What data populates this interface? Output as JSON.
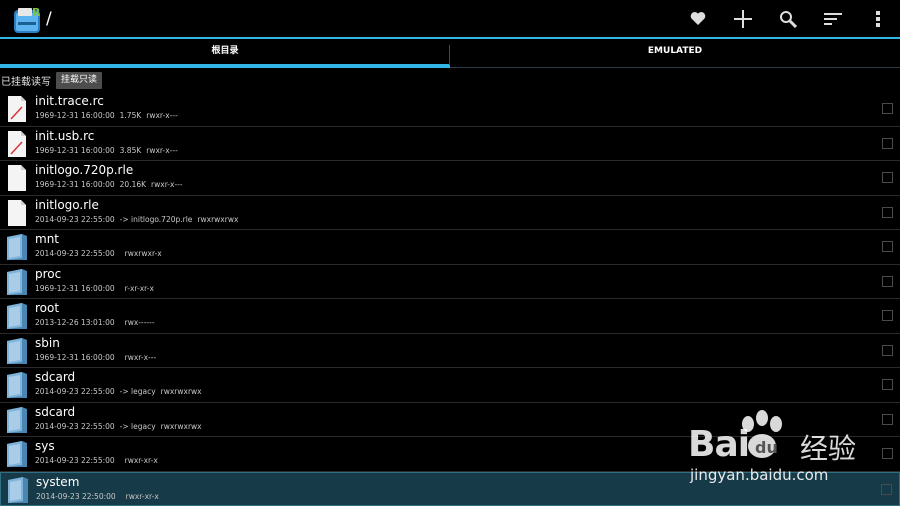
{
  "header": {
    "path": "/",
    "actions": [
      {
        "name": "favorite-icon"
      },
      {
        "name": "add-icon"
      },
      {
        "name": "search-icon"
      },
      {
        "name": "sort-icon"
      },
      {
        "name": "overflow-menu-icon"
      }
    ]
  },
  "tabs": [
    {
      "label": "根目录",
      "active": true
    },
    {
      "label": "EMULATED",
      "active": false
    }
  ],
  "mount": {
    "status": "已挂载读写",
    "button": "挂载只读"
  },
  "files": [
    {
      "name": "init.trace.rc",
      "date": "1969-12-31 16:00:00",
      "info": "1.75K",
      "perms": "rwxr-x---",
      "type": "script"
    },
    {
      "name": "init.usb.rc",
      "date": "1969-12-31 16:00:00",
      "info": "3.85K",
      "perms": "rwxr-x---",
      "type": "script"
    },
    {
      "name": "initlogo.720p.rle",
      "date": "1969-12-31 16:00:00",
      "info": "20.16K",
      "perms": "rwxr-x---",
      "type": "file"
    },
    {
      "name": "initlogo.rle",
      "date": "2014-09-23 22:55:00",
      "info": "-> initlogo.720p.rle",
      "perms": "rwxrwxrwx",
      "type": "file"
    },
    {
      "name": "mnt",
      "date": "2014-09-23 22:55:00",
      "info": "",
      "perms": "rwxrwxr-x",
      "type": "folder"
    },
    {
      "name": "proc",
      "date": "1969-12-31 16:00:00",
      "info": "",
      "perms": "r-xr-xr-x",
      "type": "folder"
    },
    {
      "name": "root",
      "date": "2013-12-26 13:01:00",
      "info": "",
      "perms": "rwx------",
      "type": "folder"
    },
    {
      "name": "sbin",
      "date": "1969-12-31 16:00:00",
      "info": "",
      "perms": "rwxr-x---",
      "type": "folder"
    },
    {
      "name": "sdcard",
      "date": "2014-09-23 22:55:00",
      "info": "-> legacy",
      "perms": "rwxrwxrwx",
      "type": "folder"
    },
    {
      "name": "sdcard",
      "date": "2014-09-23 22:55:00",
      "info": "-> legacy",
      "perms": "rwxrwxrwx",
      "type": "folder"
    },
    {
      "name": "sys",
      "date": "2014-09-23 22:55:00",
      "info": "",
      "perms": "rwxr-xr-x",
      "type": "folder"
    },
    {
      "name": "system",
      "date": "2014-09-23 22:50:00",
      "info": "",
      "perms": "rwxr-xr-x",
      "type": "folder",
      "selected": true
    }
  ],
  "watermark": {
    "brand": "Bai",
    "brand2": "经验",
    "url": "jingyan.baidu.com"
  },
  "colors": {
    "accent": "#33b5e5",
    "background": "#000000",
    "selected_row": "#163a47"
  }
}
